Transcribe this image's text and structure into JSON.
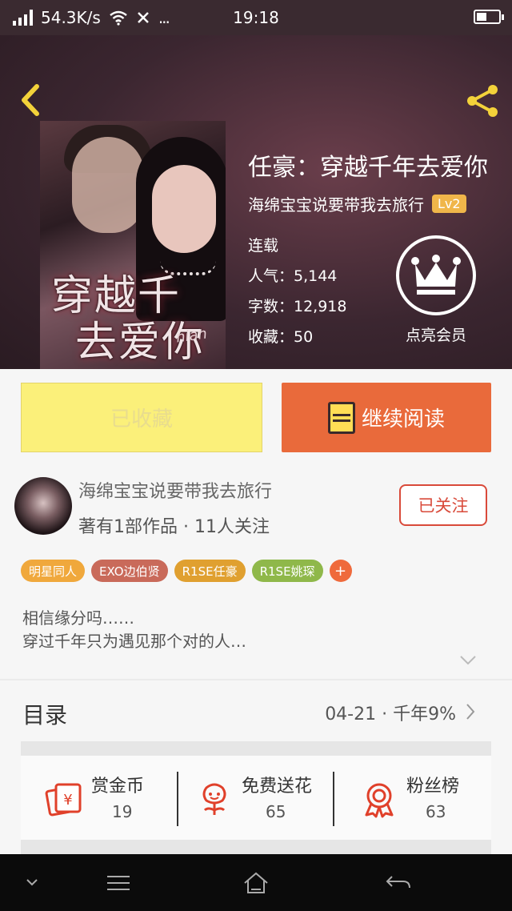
{
  "status_bar": {
    "net_speed": "54.3K/s",
    "time": "19:18"
  },
  "book": {
    "title": "任豪：穿越千年去爱你",
    "author": "海绵宝宝说要带我去旅行",
    "level": "Lv2",
    "status": "连载",
    "popularity": "人气：5,144",
    "word_count": "字数：12,918",
    "favorites": "收藏：50",
    "cover_title_line1": "穿越千",
    "cover_title_line2": "去爱你",
    "cover_subtext": "nian"
  },
  "vip": {
    "label": "点亮会员"
  },
  "actions": {
    "collected_label": "已收藏",
    "continue_label": "继续阅读"
  },
  "author_panel": {
    "name": "海绵宝宝说要带我去旅行",
    "meta": "著有1部作品 · 11人关注",
    "follow_label": "已关注"
  },
  "tags": [
    {
      "label": "明星同人",
      "color": "#f0a83c"
    },
    {
      "label": "EXO边伯贤",
      "color": "#c96a5a"
    },
    {
      "label": "R1SE任豪",
      "color": "#e0a030"
    },
    {
      "label": "R1SE姚琛",
      "color": "#8fb84a"
    },
    {
      "label": "+",
      "color": "#ef6a3c"
    }
  ],
  "description": {
    "line1": "相信缘分吗……",
    "line2": "穿过千年只为遇见那个对的人…"
  },
  "catalog": {
    "label": "目录",
    "info": "04-21 · 千年9%"
  },
  "bottom_stats": [
    {
      "label": "赏金币",
      "value": "19",
      "icon": "reward-coin-icon"
    },
    {
      "label": "免费送花",
      "value": "65",
      "icon": "flower-icon"
    },
    {
      "label": "粉丝榜",
      "value": "63",
      "icon": "fan-ranking-icon"
    }
  ]
}
